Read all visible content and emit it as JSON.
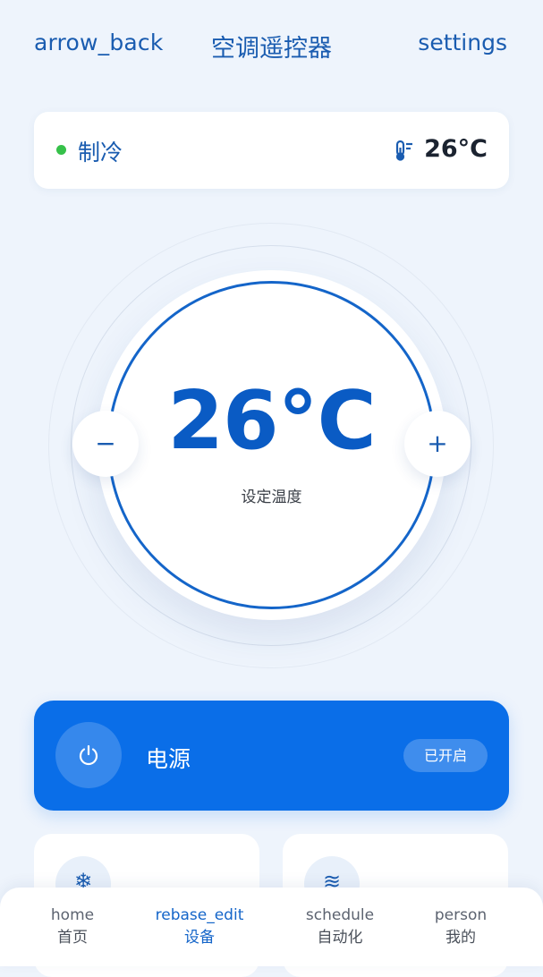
{
  "header": {
    "back_icon_text": "arrow_back",
    "title": "空调遥控器",
    "settings_icon_text": "settings"
  },
  "status": {
    "mode": "制冷",
    "mode_indicator_color": "#36c14a",
    "current_temperature": "26°C",
    "thermometer_icon": "thermometer-icon"
  },
  "dial": {
    "set_temperature": "26°C",
    "label": "设定温度",
    "minus_label": "−",
    "plus_label": "+"
  },
  "power": {
    "icon": "power-icon",
    "label": "电源",
    "state_badge": "已开启",
    "accent_color": "#0a6ee8"
  },
  "mode_cards": [
    {
      "icon": "snowflake-icon",
      "icon_glyph": "❄"
    },
    {
      "icon": "wind-icon",
      "icon_glyph": "≋"
    }
  ],
  "bottom_nav": {
    "items": [
      {
        "icon_text": "home",
        "label": "首页",
        "active": false
      },
      {
        "icon_text": "rebase_edit",
        "label": "设备",
        "active": true
      },
      {
        "icon_text": "schedule",
        "label": "自动化",
        "active": false
      },
      {
        "icon_text": "person",
        "label": "我的",
        "active": false
      }
    ]
  }
}
